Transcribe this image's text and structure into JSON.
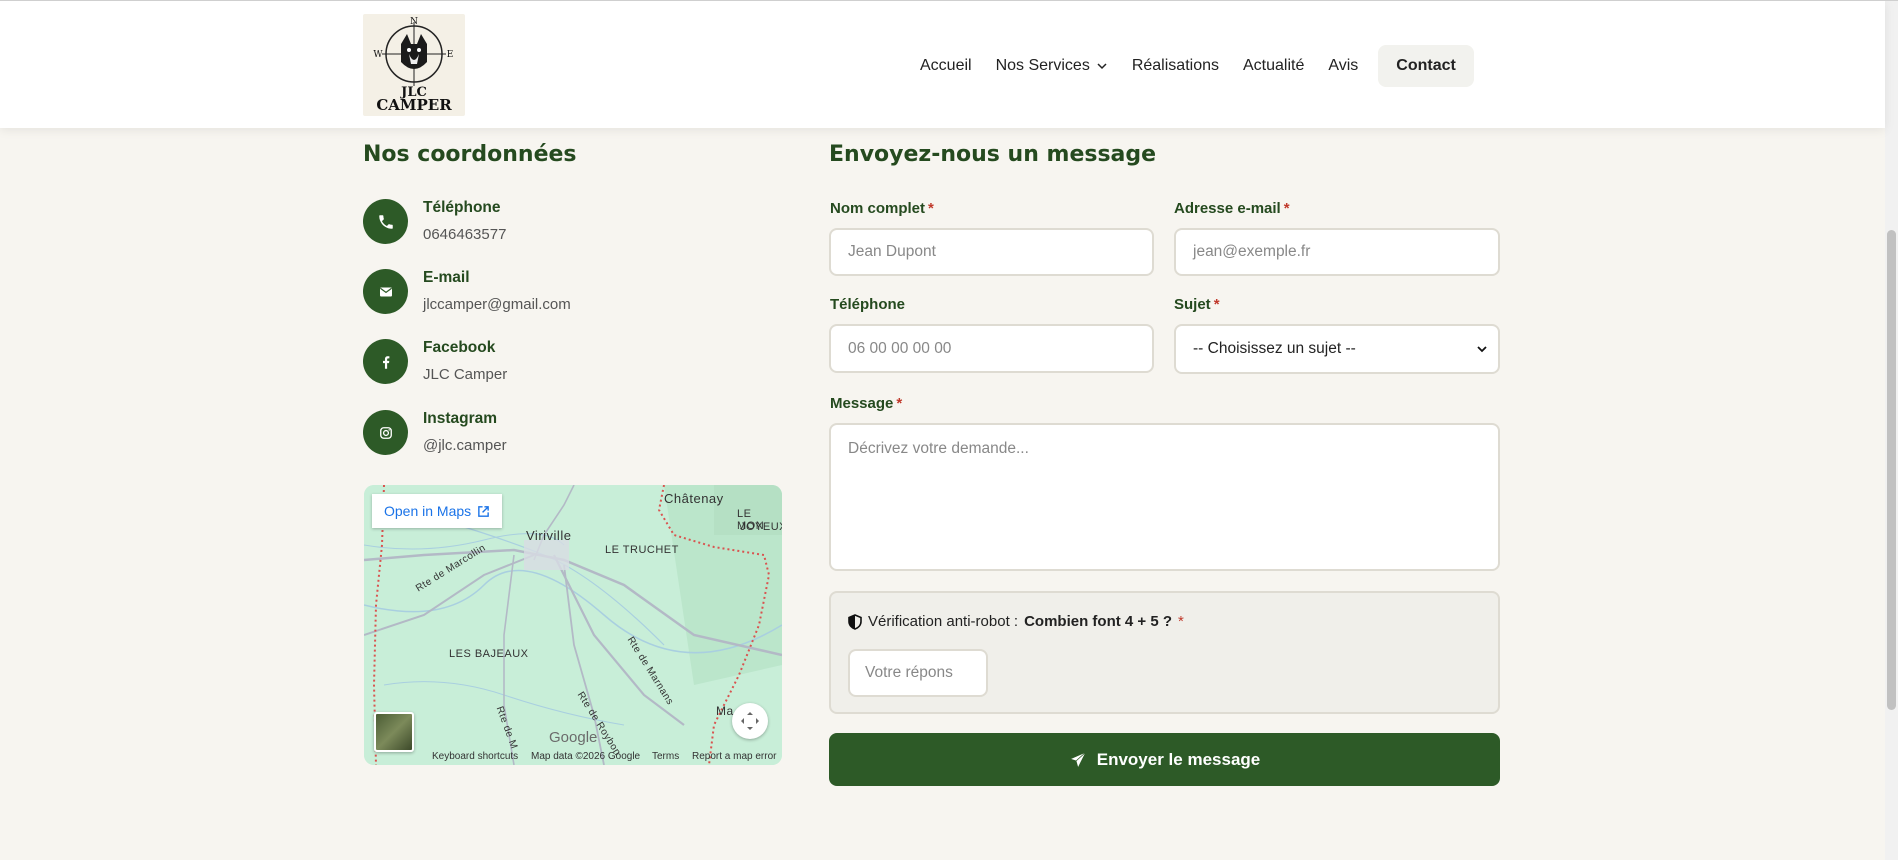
{
  "header": {
    "logo_text": [
      "JLC",
      "CAMPER"
    ],
    "logo_compass": [
      "N",
      "W",
      "E"
    ],
    "nav": [
      {
        "label": "Accueil"
      },
      {
        "label": "Nos Services"
      },
      {
        "label": "Réalisations"
      },
      {
        "label": "Actualité"
      },
      {
        "label": "Avis"
      },
      {
        "label": "Contact"
      }
    ]
  },
  "coordonnees": {
    "title": "Nos coordonnées",
    "items": [
      {
        "label": "Téléphone",
        "value": "0646463577",
        "icon": "phone-icon"
      },
      {
        "label": "E-mail",
        "value": "jlccamper@gmail.com",
        "icon": "mail-icon"
      },
      {
        "label": "Facebook",
        "value": "JLC Camper",
        "icon": "facebook-icon"
      },
      {
        "label": "Instagram",
        "value": "@jlc.camper",
        "icon": "instagram-icon"
      }
    ]
  },
  "map": {
    "open_label": "Open in Maps",
    "places": [
      "Châtenay",
      "LE MON",
      "JOYEUX",
      "Viriville",
      "LE TRUCHET",
      "LES BAJEAUX",
      "Rte de Marcollin",
      "Rte de Marnans",
      "Rte de Roybon",
      "Rte de M",
      "Ma"
    ],
    "footer": [
      "Keyboard shortcuts",
      "Map data ©2026 Google",
      "Terms",
      "Report a map error"
    ],
    "brand": "Google"
  },
  "form": {
    "title": "Envoyez-nous un message",
    "name": {
      "label": "Nom complet",
      "placeholder": "Jean Dupont"
    },
    "email": {
      "label": "Adresse e-mail",
      "placeholder": "jean@exemple.fr"
    },
    "phone": {
      "label": "Téléphone",
      "placeholder": "06 00 00 00 00"
    },
    "subject": {
      "label": "Sujet",
      "selected": "-- Choisissez un sujet --"
    },
    "message": {
      "label": "Message",
      "placeholder": "Décrivez votre demande..."
    },
    "captcha": {
      "label": "Vérification anti-robot :",
      "question": "Combien font 4 + 5 ?",
      "placeholder": "Votre répons"
    },
    "required_mark": "*",
    "submit_label": "Envoyer le message"
  },
  "colors": {
    "brand_green": "#2d5a27",
    "title_green": "#254a1f",
    "required_red": "#c0392b",
    "background": "#f7f5f0"
  }
}
